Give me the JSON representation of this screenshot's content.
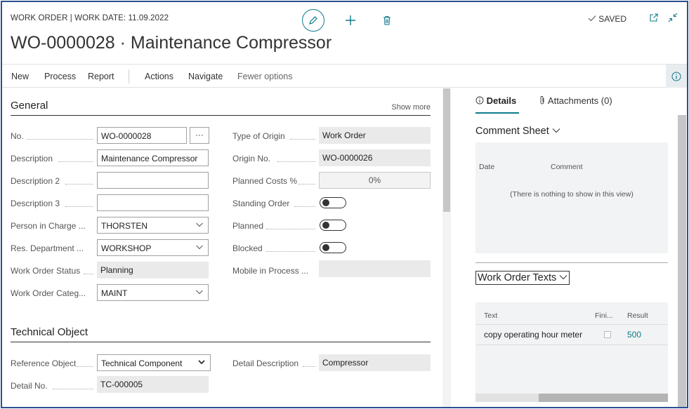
{
  "header": {
    "caption": "WORK ORDER | WORK DATE: 11.09.2022",
    "title": "WO-0000028 · Maintenance Compressor",
    "saved_label": "SAVED",
    "icons": {
      "edit": "pencil-icon",
      "add": "plus-icon",
      "delete": "trash-icon",
      "popout": "popout-icon",
      "collapse": "collapse-icon"
    }
  },
  "actionbar": {
    "items": [
      "New",
      "Process",
      "Report",
      "Actions",
      "Navigate",
      "Fewer options"
    ],
    "info_icon": "info-icon"
  },
  "general": {
    "title": "General",
    "show_more": "Show more",
    "left_fields": [
      {
        "label": "No.",
        "value": "WO-0000028",
        "kind": "input-lookup"
      },
      {
        "label": "Description",
        "value": "Maintenance Compressor",
        "kind": "input"
      },
      {
        "label": "Description 2",
        "value": "",
        "kind": "input"
      },
      {
        "label": "Description 3",
        "value": "",
        "kind": "input"
      },
      {
        "label": "Person in Charge ...",
        "value": "THORSTEN",
        "kind": "select"
      },
      {
        "label": "Res. Department ...",
        "value": "WORKSHOP",
        "kind": "select"
      },
      {
        "label": "Work Order Status",
        "value": "Planning",
        "kind": "readonly"
      },
      {
        "label": "Work Order Categ...",
        "value": "MAINT",
        "kind": "select"
      }
    ],
    "right_fields": [
      {
        "label": "Type of Origin",
        "value": "Work Order",
        "kind": "readonly"
      },
      {
        "label": "Origin No.",
        "value": "WO-0000026",
        "kind": "readonly"
      },
      {
        "label": "Planned Costs %",
        "value": "0%",
        "kind": "percent"
      },
      {
        "label": "Standing Order",
        "value": "",
        "kind": "toggle"
      },
      {
        "label": "Planned",
        "value": "",
        "kind": "toggle"
      },
      {
        "label": "Blocked",
        "value": "",
        "kind": "toggle"
      },
      {
        "label": "Mobile in Process ...",
        "value": "",
        "kind": "readonly"
      }
    ]
  },
  "technical_object": {
    "title": "Technical Object",
    "fields": [
      {
        "label": "Reference Object",
        "value": "Technical Component",
        "kind": "dropdown"
      },
      {
        "label": "Detail No.",
        "value": "TC-000005",
        "kind": "readonly"
      },
      {
        "label": "Detail Description",
        "value": "Compressor",
        "kind": "readonly"
      }
    ]
  },
  "factbox": {
    "tabs": {
      "details": "Details",
      "attachments": "Attachments (0)"
    },
    "comment_sheet": {
      "title": "Comment Sheet",
      "columns": [
        "Date",
        "Comment"
      ],
      "empty_message": "(There is nothing to show in this view)"
    },
    "work_order_texts": {
      "title": "Work Order Texts",
      "columns": [
        "Text",
        "Fini...",
        "Result"
      ],
      "rows": [
        {
          "text": "copy operating hour meter",
          "result": "500"
        }
      ]
    }
  },
  "colors": {
    "accent": "#0e7a8a",
    "frame": "#2a5090"
  }
}
